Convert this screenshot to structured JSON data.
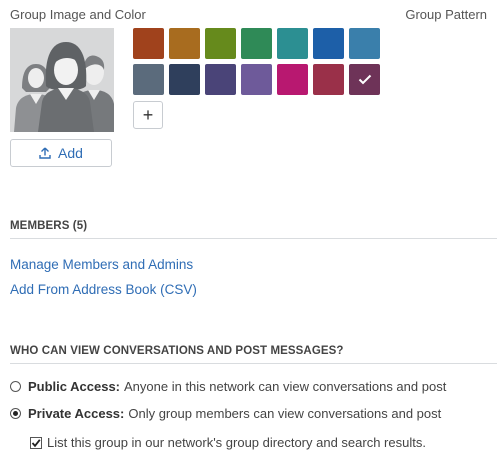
{
  "header": {
    "group_image_label": "Group Image and Color",
    "group_pattern_label": "Group Pattern"
  },
  "image_upload": {
    "add_label": "Add"
  },
  "colors": [
    {
      "hex": "#a0421c",
      "selected": false
    },
    {
      "hex": "#a86c1f",
      "selected": false
    },
    {
      "hex": "#668a1c",
      "selected": false
    },
    {
      "hex": "#2f8a57",
      "selected": false
    },
    {
      "hex": "#2c8f92",
      "selected": false
    },
    {
      "hex": "#1d5fa8",
      "selected": false
    },
    {
      "hex": "#3a7fab",
      "selected": false
    },
    {
      "hex": "#5b6b7c",
      "selected": false
    },
    {
      "hex": "#2f3f5c",
      "selected": false
    },
    {
      "hex": "#4a4478",
      "selected": false
    },
    {
      "hex": "#6e5a9a",
      "selected": false
    },
    {
      "hex": "#b81870",
      "selected": false
    },
    {
      "hex": "#9a3049",
      "selected": false
    },
    {
      "hex": "#6e3358",
      "selected": true
    }
  ],
  "add_color": {
    "label": "+"
  },
  "members": {
    "title": "MEMBERS (5)",
    "manage_link": "Manage Members and Admins",
    "address_book_link": "Add From Address Book (CSV)"
  },
  "access": {
    "title": "WHO CAN VIEW CONVERSATIONS AND POST MESSAGES?",
    "public_label": "Public Access:",
    "public_desc": "Anyone in this network can view conversations and post",
    "public_selected": false,
    "private_label": "Private Access:",
    "private_desc": "Only group members can view conversations and post",
    "private_selected": true,
    "list_in_directory_label": "List this group in our network's group directory and search results.",
    "list_in_directory_checked": true
  }
}
